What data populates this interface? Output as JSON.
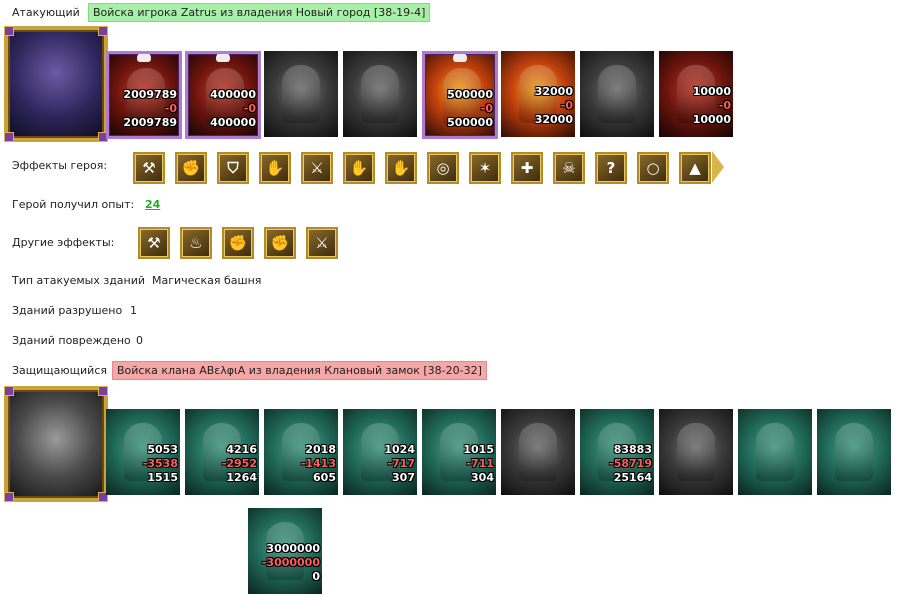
{
  "attacker": {
    "label": "Атакующий",
    "title": "Войска игрока Zatrus из владения Новый город [38-19-4]",
    "units": [
      {
        "name": "beast-unit",
        "count": "2009789",
        "loss": "-0",
        "left": "2009789"
      },
      {
        "name": "lich-unit",
        "count": "400000",
        "loss": "-0",
        "left": "400000"
      },
      {
        "name": "ghost-wolf-unit"
      },
      {
        "name": "gargoyle-unit"
      },
      {
        "name": "fire-golem-unit",
        "count": "500000",
        "loss": "-0",
        "left": "500000"
      },
      {
        "name": "fire-titan-unit",
        "count": "32000",
        "loss": "-0",
        "left": "32000"
      },
      {
        "name": "bone-knight-unit"
      },
      {
        "name": "reaper-unit",
        "count": "10000",
        "loss": "-0",
        "left": "10000"
      }
    ]
  },
  "hero_effects": {
    "label": "Эффекты героя:",
    "icons": [
      "barracks-icon",
      "dice-fist-icon",
      "shield-icon",
      "hand-shield-icon",
      "sword-icon",
      "hand-sword-icon",
      "hand-magic-icon",
      "coins-icon",
      "claw-icon",
      "cross-icon",
      "demon-mask-icon",
      "question-icon",
      "ring-icon",
      "crystal-icon"
    ],
    "glyphs": [
      "⚒",
      "✊",
      "⛉",
      "✋",
      "⚔",
      "✋",
      "✋",
      "◎",
      "✶",
      "✚",
      "☠",
      "?",
      "○",
      "▲"
    ]
  },
  "experience": {
    "label": "Герой получил опыт:",
    "value": "24"
  },
  "other_effects": {
    "label": "Другие эффекты:",
    "icons": [
      "armor-icon",
      "potion-icon",
      "fist-heart-icon",
      "fist-heart-icon",
      "sword-icon"
    ],
    "glyphs": [
      "⚒",
      "♨",
      "✊",
      "✊",
      "⚔"
    ]
  },
  "buildings": {
    "type_label": "Тип атакуемых зданий",
    "type_value": "Магическая башня",
    "destroyed_label": "Зданий разрушено",
    "destroyed_value": "1",
    "damaged_label": "Зданий повреждено",
    "damaged_value": "0"
  },
  "defender": {
    "label": "Защищающийся",
    "title": "Войска клана ΑΒελφιΑ из владения Клановый замок [38-20-32]",
    "units": [
      {
        "name": "spiked-beast-unit",
        "count": "5053",
        "loss": "-3538",
        "left": "1515"
      },
      {
        "name": "armored-demon-unit",
        "count": "4216",
        "loss": "-2952",
        "left": "1264"
      },
      {
        "name": "orc-shaman-unit",
        "count": "2018",
        "loss": "-1413",
        "left": "605"
      },
      {
        "name": "winged-demon-unit",
        "count": "1024",
        "loss": "-717",
        "left": "307"
      },
      {
        "name": "bone-spider-unit",
        "count": "1015",
        "loss": "-711",
        "left": "304"
      },
      {
        "name": "shadow-unit"
      },
      {
        "name": "flesh-tower-unit",
        "count": "83883",
        "loss": "-58719",
        "left": "25164"
      },
      {
        "name": "dark-fiend-unit"
      },
      {
        "name": "flesh-altar-unit"
      },
      {
        "name": "flesh-hive-unit"
      },
      {
        "name": "flesh-wall-unit",
        "count": "3000000",
        "loss": "-3000000",
        "left": "0"
      }
    ]
  }
}
